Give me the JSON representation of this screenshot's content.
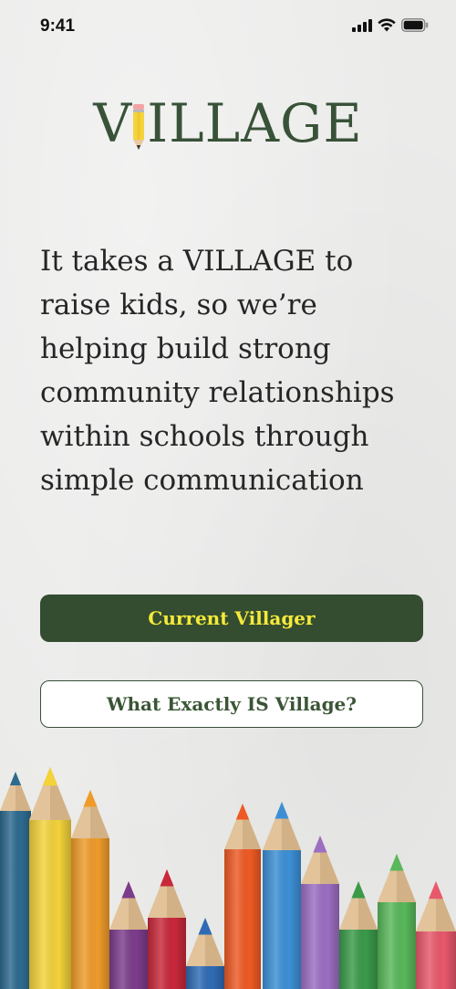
{
  "status_bar": {
    "time": "9:41"
  },
  "logo": {
    "pencil_letter": "I",
    "text": "ILLAGE",
    "full_name": "VILLAGE",
    "color": "#385238"
  },
  "tagline": {
    "lines": [
      "It takes a VILLAGE to",
      "raise kids, so we’re",
      "helping build strong",
      "community relationships",
      "within schools through",
      "simple communication"
    ]
  },
  "buttons": {
    "primary_label": "Current Villager",
    "secondary_label": "What Exactly IS Village?",
    "primary_bg": "#344d30",
    "primary_text_color": "#f5ea3a",
    "secondary_text_color": "#3a5535"
  },
  "decoration": {
    "icon": "colored-pencils-illustration",
    "pencil_colors": [
      "#2d6a8f",
      "#f3d23a",
      "#ef9b2a",
      "#7c3c8c",
      "#c8283a",
      "#2f6bb4",
      "#ee5a24",
      "#3c8fd6",
      "#9b6ec2",
      "#3a9a4a",
      "#58b85a",
      "#e8586b"
    ]
  }
}
